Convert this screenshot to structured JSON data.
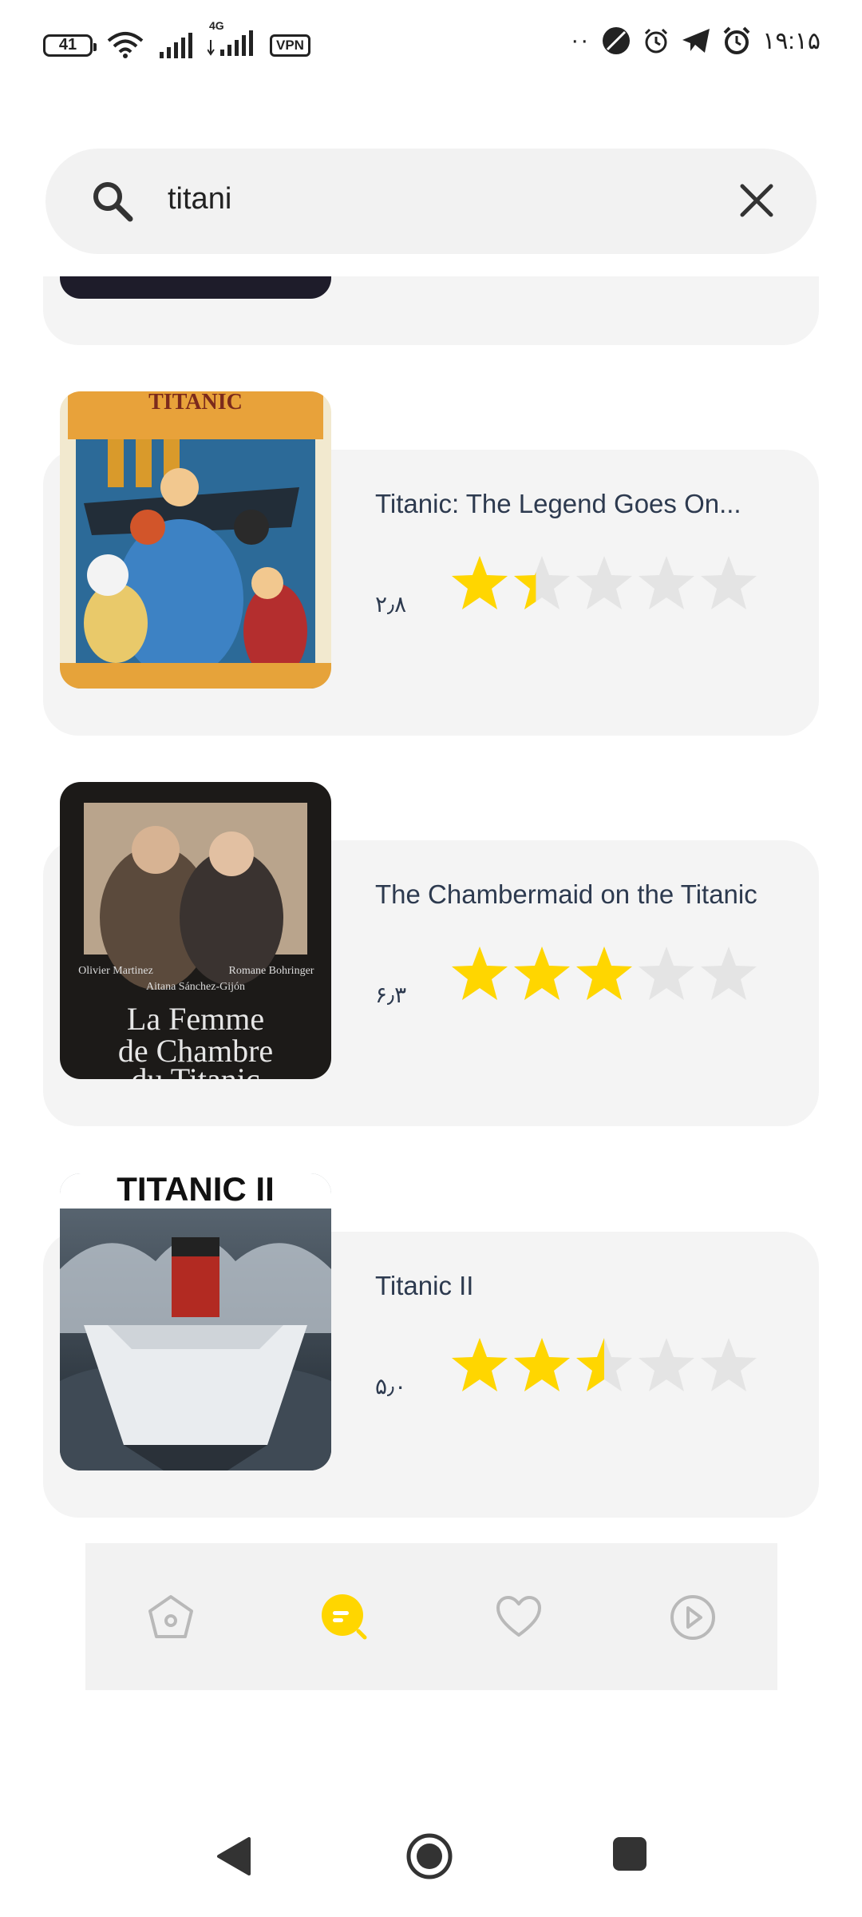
{
  "status_bar": {
    "battery": "41",
    "network": "4G",
    "vpn": "VPN",
    "time": "۱۹:۱۵"
  },
  "search": {
    "query": "titani",
    "search_icon": "search-icon",
    "clear_icon": "close-icon"
  },
  "results": [
    {
      "title": "Titanic: The Legend Goes On...",
      "rating": "۲٫۸",
      "stars": 1.4,
      "poster": {
        "caption": "TITANIC"
      }
    },
    {
      "title": "The Chambermaid on the Titanic",
      "rating": "۶٫۳",
      "stars": 3,
      "poster": {
        "credit_1": "Olivier Martinez",
        "credit_2": "Aitana Sánchez-Gijón",
        "credit_3": "Romane Bohringer",
        "title_line_1": "La Femme",
        "title_line_2": "de Chambre",
        "title_line_3": "du Titanic"
      }
    },
    {
      "title": "Titanic II",
      "rating": "۵٫۰",
      "stars": 2.5,
      "poster": {
        "caption": "TITANIC II"
      }
    }
  ],
  "bottom_nav": {
    "items": [
      {
        "icon": "home-icon",
        "active": false
      },
      {
        "icon": "search-icon",
        "active": true
      },
      {
        "icon": "heart-icon",
        "active": false
      },
      {
        "icon": "play-icon",
        "active": false
      }
    ],
    "active_color": "#ffd600",
    "inactive_color": "#b9b9b9"
  },
  "colors": {
    "star_filled": "#ffd600",
    "star_empty": "#e4e4e4",
    "card_bg": "#f4f4f4"
  }
}
